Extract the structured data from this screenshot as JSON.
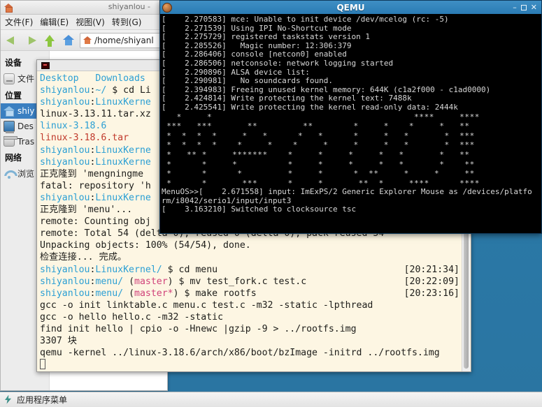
{
  "desktop": {
    "background_color": "#2b7cab"
  },
  "filemanager": {
    "title": "shiyanlou -",
    "window_icon": "home-icon",
    "menu": [
      {
        "label": "文件(F)"
      },
      {
        "label": "编辑(E)"
      },
      {
        "label": "视图(V)"
      },
      {
        "label": "转到(G)"
      }
    ],
    "toolbar": {
      "back_icon": "back-arrow-icon",
      "forward_icon": "forward-arrow-icon",
      "up_icon": "up-arrow-icon",
      "home_icon": "home-icon",
      "location_icon": "home-icon",
      "location_value": "/home/shiyanl",
      "location_placeholder": "/home/shiyanlou"
    },
    "sidebar": {
      "groups": [
        {
          "heading": "设备",
          "items": [
            {
              "label": "文件",
              "icon": "drive-icon",
              "selected": false
            }
          ]
        },
        {
          "heading": "位置",
          "items": [
            {
              "label": "shiy",
              "icon": "home-icon",
              "selected": true
            },
            {
              "label": "Des",
              "icon": "desktop-icon",
              "selected": false
            },
            {
              "label": "Tras",
              "icon": "trash-icon",
              "selected": false
            }
          ]
        },
        {
          "heading": "网络",
          "items": [
            {
              "label": "浏览",
              "icon": "wifi-icon",
              "selected": false
            }
          ]
        }
      ]
    }
  },
  "terminal": {
    "tab_icon": "terminal-icon",
    "scrollbar": "vertical-scrollbar",
    "lines": [
      {
        "segments": [
          {
            "text": "Desktop   Downloads",
            "color": "blue"
          }
        ]
      },
      {
        "segments": [
          {
            "text": "shiyanlou",
            "color": "blue"
          },
          {
            "text": ":",
            "color": "plain"
          },
          {
            "text": "~/",
            "color": "blue"
          },
          {
            "text": " $ cd Li",
            "color": "plain"
          }
        ]
      },
      {
        "segments": [
          {
            "text": "shiyanlou",
            "color": "blue"
          },
          {
            "text": ":",
            "color": "plain"
          },
          {
            "text": "LinuxKerne",
            "color": "blue"
          }
        ]
      },
      {
        "segments": [
          {
            "text": "linux-3.13.11.tar.xz",
            "color": "plain"
          }
        ]
      },
      {
        "segments": [
          {
            "text": "linux-3.18.6",
            "color": "blue"
          }
        ]
      },
      {
        "segments": [
          {
            "text": "linux-3.18.6.tar",
            "color": "red"
          }
        ]
      },
      {
        "segments": [
          {
            "text": "shiyanlou",
            "color": "blue"
          },
          {
            "text": ":",
            "color": "plain"
          },
          {
            "text": "LinuxKerne",
            "color": "blue"
          }
        ]
      },
      {
        "segments": [
          {
            "text": "shiyanlou",
            "color": "blue"
          },
          {
            "text": ":",
            "color": "plain"
          },
          {
            "text": "LinuxKerne",
            "color": "blue"
          }
        ]
      },
      {
        "segments": [
          {
            "text": "正克隆到 'mengningme",
            "color": "plain"
          }
        ]
      },
      {
        "segments": [
          {
            "text": "fatal: repository 'h",
            "color": "plain"
          }
        ]
      },
      {
        "segments": [
          {
            "text": "shiyanlou",
            "color": "blue"
          },
          {
            "text": ":",
            "color": "plain"
          },
          {
            "text": "LinuxKerne",
            "color": "blue"
          }
        ]
      },
      {
        "segments": [
          {
            "text": "正克隆到 'menu'...",
            "color": "plain"
          }
        ]
      },
      {
        "segments": [
          {
            "text": "remote: Counting obj",
            "color": "plain"
          }
        ]
      },
      {
        "segments": [
          {
            "text": "remote: Total 54 (delta 0), reused 0 (delta 0), pack-reused 54",
            "color": "plain"
          }
        ]
      },
      {
        "segments": [
          {
            "text": "Unpacking objects: 100% (54/54), done.",
            "color": "plain"
          }
        ]
      },
      {
        "segments": [
          {
            "text": "检查连接... 完成。",
            "color": "plain"
          }
        ]
      },
      {
        "segments": [
          {
            "text": "shiyanlou",
            "color": "blue"
          },
          {
            "text": ":",
            "color": "plain"
          },
          {
            "text": "LinuxKernel/",
            "color": "blue"
          },
          {
            "text": " $ cd menu",
            "color": "plain"
          }
        ],
        "timestamp": "[20:21:34]"
      },
      {
        "segments": [
          {
            "text": "shiyanlou",
            "color": "blue"
          },
          {
            "text": ":",
            "color": "plain"
          },
          {
            "text": "menu/",
            "color": "blue"
          },
          {
            "text": " (",
            "color": "plain"
          },
          {
            "text": "master",
            "color": "magenta"
          },
          {
            "text": ") $ mv test_fork.c test.c",
            "color": "plain"
          }
        ],
        "timestamp": "[20:22:09]"
      },
      {
        "segments": [
          {
            "text": "shiyanlou",
            "color": "blue"
          },
          {
            "text": ":",
            "color": "plain"
          },
          {
            "text": "menu/",
            "color": "blue"
          },
          {
            "text": " (",
            "color": "plain"
          },
          {
            "text": "master*",
            "color": "magenta"
          },
          {
            "text": ") $ make rootfs",
            "color": "plain"
          }
        ],
        "timestamp": "[20:23:16]"
      },
      {
        "segments": [
          {
            "text": "gcc -o init linktable.c menu.c test.c -m32 -static -lpthread",
            "color": "plain"
          }
        ]
      },
      {
        "segments": [
          {
            "text": "gcc -o hello hello.c -m32 -static",
            "color": "plain"
          }
        ]
      },
      {
        "segments": [
          {
            "text": "find init hello | cpio -o -Hnewc |gzip -9 > ../rootfs.img",
            "color": "plain"
          }
        ]
      },
      {
        "segments": [
          {
            "text": "3307 块",
            "color": "plain"
          }
        ]
      },
      {
        "segments": [
          {
            "text": "qemu -kernel ../linux-3.18.6/arch/x86/boot/bzImage -initrd ../rootfs.img",
            "color": "plain"
          }
        ]
      }
    ]
  },
  "qemu": {
    "title": "QEMU",
    "window_icon": "qemu-icon",
    "buttons": {
      "minimize": "–",
      "maximize": "maximize-icon",
      "close": "✕"
    },
    "boot_log_top": [
      "[    2.270583] mce: Unable to init device /dev/mcelog (rc: -5)",
      "[    2.271539] Using IPI No-Shortcut mode",
      "[    2.275729] registered taskstats version 1",
      "[    2.285526]   Magic number: 12:306:379",
      "[    2.286406] console [netcon0] enabled",
      "[    2.286506] netconsole: network logging started",
      "[    2.290896] ALSA device list:",
      "[    2.290981]   No soundcards found.",
      "[    2.394983] Freeing unused kernel memory: 644K (c1a2f000 - c1ad0000)",
      "[    2.424814] Write protecting the kernel text: 7488k",
      "[    2.425541] Write protecting the kernel read-only data: 2444k"
    ],
    "ascii_banner": [
      "   *     *                                        ****     ****",
      " ***   ***       **         **        *     *    *     *   **",
      " *  *  *  *     *   *      *   *      *     *   *       *  ***",
      " *  *  *  *    *     *    *     *     *     *   *       *  ***",
      " *   ** *     *******    *     *     *     *   *       *   **",
      " *      *     *          *     *     *     *   *       *    **",
      " *      *      *         *     *      *  **     *     *     **",
      " *      *       ***      *     *       **  *     ****      ****"
    ],
    "prompt_line": "MenuOS>>[    2.671558] input: ImExPS/2 Generic Explorer Mouse as /devices/platfo",
    "boot_log_bottom": [
      "rm/i8042/serio1/input/input3",
      "[    3.163210] Switched to clocksource tsc"
    ]
  },
  "taskbar": {
    "menu_icon": "applications-menu-icon",
    "menu_label": "应用程序菜单"
  }
}
